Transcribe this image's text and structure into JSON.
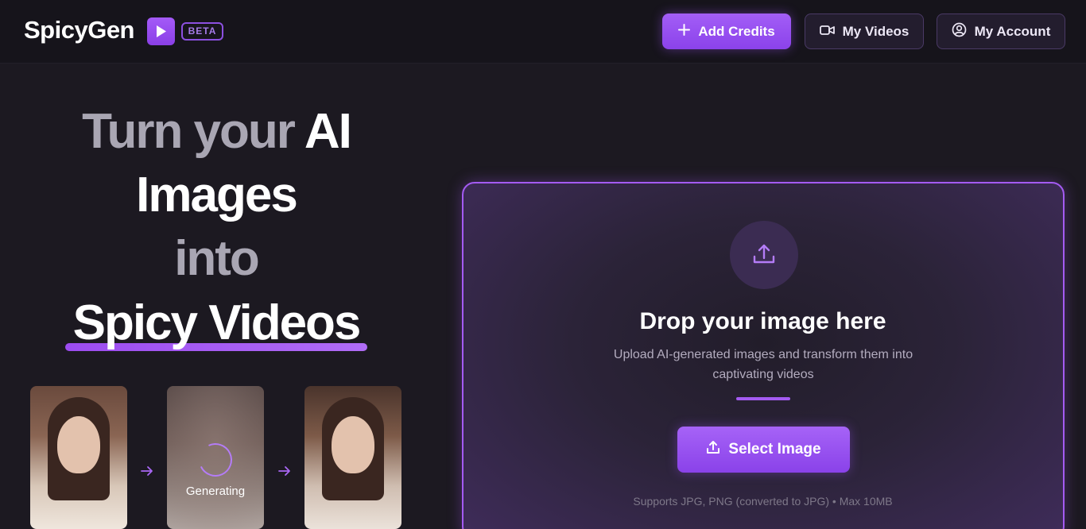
{
  "header": {
    "logo_text": "SpicyGen",
    "logo_icon": "play-icon",
    "beta_label": "BETA",
    "add_credits_label": "Add Credits",
    "my_videos_label": "My Videos",
    "my_account_label": "My Account"
  },
  "hero": {
    "line1_part1": "Turn your ",
    "line1_part2": "AI",
    "line2": "Images",
    "line3": "into",
    "line4": "Spicy Videos"
  },
  "preview": {
    "generating_label": "Generating"
  },
  "dropzone": {
    "icon": "upload-icon",
    "title": "Drop your image here",
    "subtitle": "Upload AI-generated images and transform them into captivating videos",
    "select_button_label": "Select Image",
    "support_text": "Supports JPG, PNG (converted to JPG) • Max 10MB"
  },
  "colors": {
    "accent": "#9b51f0",
    "background": "#1c1921",
    "header_bg": "#16141b"
  }
}
